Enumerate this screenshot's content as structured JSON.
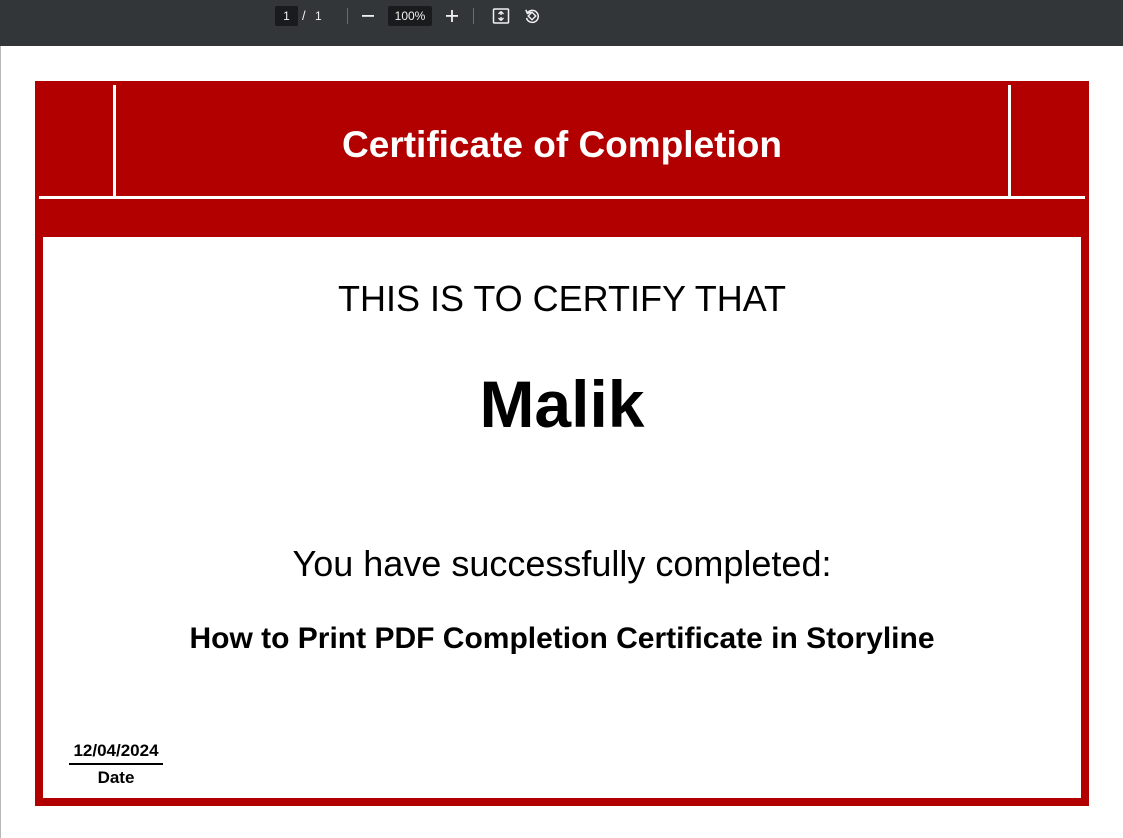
{
  "toolbar": {
    "current_page": "1",
    "page_separator": "/",
    "total_pages": "1",
    "zoom_level": "100%",
    "icons": [
      "minus-icon",
      "plus-icon",
      "fit-page-icon",
      "rotate-icon"
    ]
  },
  "certificate": {
    "title": "Certificate of Completion",
    "certify_text": "THIS IS TO CERTIFY THAT",
    "recipient_name": "Malik",
    "completed_text": "You have successfully completed:",
    "course_title": "How to Print PDF Completion Certificate in Storyline",
    "date_value": "12/04/2024",
    "date_label": "Date"
  },
  "colors": {
    "toolbar_bg": "#323639",
    "certificate_red": "#b20000",
    "certificate_body": "#ffffff",
    "text": "#000000"
  }
}
